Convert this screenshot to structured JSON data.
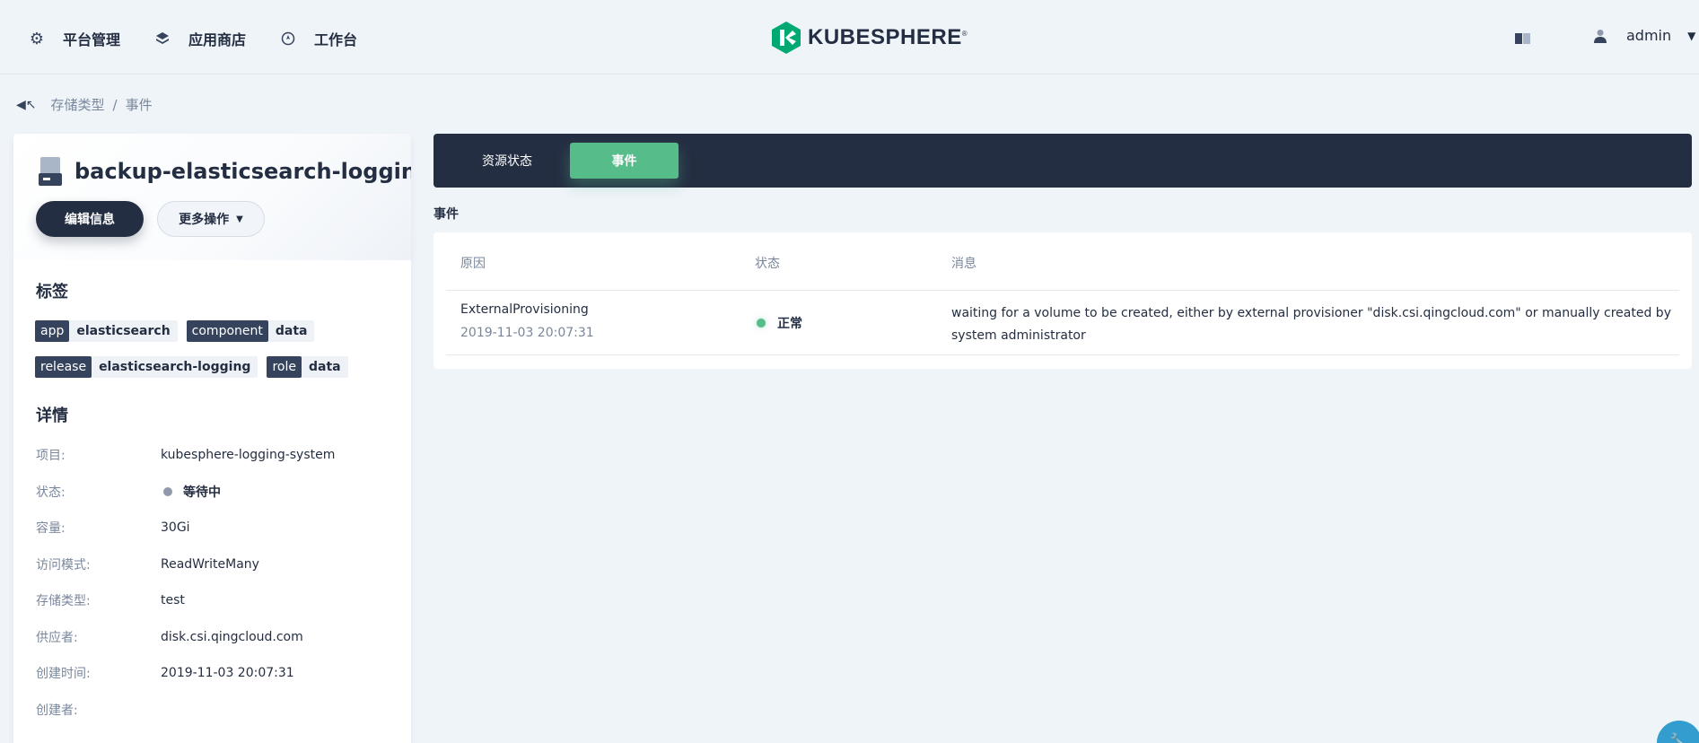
{
  "nav": {
    "items": [
      {
        "label": "平台管理",
        "icon": "gear-icon"
      },
      {
        "label": "应用商店",
        "icon": "stack-icon"
      },
      {
        "label": "工作台",
        "icon": "compass-icon"
      }
    ],
    "logo_text": "KUBESPHERE",
    "logo_mark": "®",
    "user": "admin",
    "brand_color": "#00a971"
  },
  "breadcrumb": {
    "items": [
      "存储类型",
      "事件"
    ],
    "separator": "/"
  },
  "volume": {
    "name": "backup-elasticsearch-loggin...",
    "edit_label": "编辑信息",
    "more_label": "更多操作"
  },
  "labels": {
    "title": "标签",
    "tags": [
      {
        "key": "app",
        "value": "elasticsearch"
      },
      {
        "key": "component",
        "value": "data"
      },
      {
        "key": "release",
        "value": "elasticsearch-logging"
      },
      {
        "key": "role",
        "value": "data"
      }
    ]
  },
  "details": {
    "title": "详情",
    "rows": [
      {
        "label": "项目:",
        "value": "kubesphere-logging-system"
      },
      {
        "label": "状态:",
        "value": "等待中"
      },
      {
        "label": "容量:",
        "value": "30Gi"
      },
      {
        "label": "访问模式:",
        "value": "ReadWriteMany"
      },
      {
        "label": "存储类型:",
        "value": "test"
      },
      {
        "label": "供应者:",
        "value": "disk.csi.qingcloud.com"
      },
      {
        "label": "创建时间:",
        "value": "2019-11-03 20:07:31"
      },
      {
        "label": "创建者:",
        "value": ""
      }
    ]
  },
  "tabs": [
    {
      "label": "资源状态",
      "active": false
    },
    {
      "label": "事件",
      "active": true
    }
  ],
  "events": {
    "section_label": "事件",
    "columns": [
      "原因",
      "状态",
      "消息"
    ],
    "rows": [
      {
        "reason": "ExternalProvisioning",
        "time": "2019-11-03 20:07:31",
        "status": "正常",
        "message": "waiting for a volume to be created, either by external provisioner \"disk.csi.qingcloud.com\" or manually created by system administrator"
      }
    ]
  },
  "colors": {
    "accent_green": "#55bc8a",
    "dark": "#242e42",
    "pending_gray": "#8f99ab",
    "help_blue": "#329dce"
  }
}
